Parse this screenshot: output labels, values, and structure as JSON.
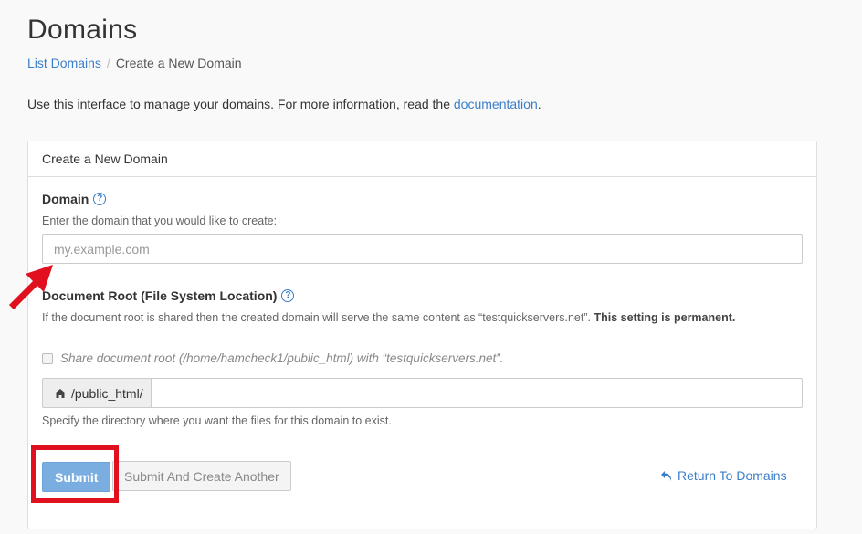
{
  "page": {
    "title": "Domains",
    "breadcrumb": {
      "link": "List Domains",
      "separator": "/",
      "current": "Create a New Domain"
    },
    "intro": {
      "text": "Use this interface to manage your domains. For more information, read the ",
      "link": "documentation",
      "suffix": "."
    }
  },
  "panel": {
    "heading": "Create a New Domain",
    "domain": {
      "label": "Domain",
      "help_icon": "question-circle-icon",
      "hint": "Enter the domain that you would like to create:",
      "placeholder": "my.example.com",
      "value": ""
    },
    "document_root": {
      "label": "Document Root (File System Location)",
      "help_icon": "question-circle-icon",
      "description": "If the document root is shared then the created domain will serve the same content as “testquickservers.net”. ",
      "description_bold": "This setting is permanent.",
      "share_checkbox_label": "Share document root (/home/hamcheck1/public_html) with “testquickservers.net”.",
      "share_checked": false,
      "prefix": "/public_html/",
      "prefix_icon": "home-icon",
      "value": "",
      "hint": "Specify the directory where you want the files for this domain to exist."
    },
    "actions": {
      "submit": "Submit",
      "submit_another": "Submit And Create Another",
      "return": "Return To Domains",
      "return_icon": "undo-arrow-icon"
    }
  },
  "annotations": {
    "arrow_color": "#e0101e",
    "highlight_color": "#e0101e"
  }
}
